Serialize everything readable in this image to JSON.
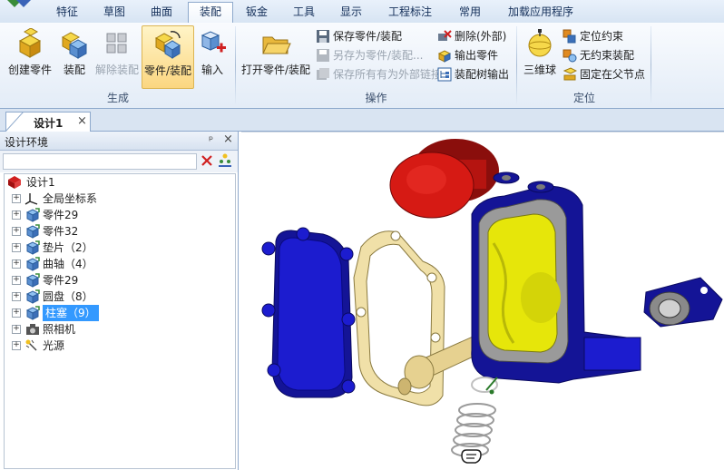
{
  "tabs": [
    "特征",
    "草图",
    "曲面",
    "装配",
    "钣金",
    "工具",
    "显示",
    "工程标注",
    "常用",
    "加载应用程序"
  ],
  "active_tab": "装配",
  "ribbon": {
    "groups": {
      "generate": "生成",
      "operate": "操作",
      "locate": "定位"
    },
    "buttons": {
      "create_part": "创建零件",
      "assemble": "装配",
      "disassemble": "解除装配",
      "part_assembly": "零件/装配",
      "import": "输入",
      "open_part_assembly": "打开零件/装配",
      "save_part_assembly": "保存零件/装配",
      "save_as_part_assembly": "另存为零件/装配...",
      "save_all_external": "保存所有有为外部链接",
      "delete_external": "删除(外部)",
      "export_part": "输出零件",
      "export_assembly_tree": "装配树输出",
      "triball": "三维球",
      "locate_constraint": "定位约束",
      "unconstrained_assembly": "无约束装配",
      "fix_at_parent": "固定在父节点"
    }
  },
  "document": {
    "tab_title": "设计1",
    "close_glyph": "×"
  },
  "panel": {
    "title": "设计环境",
    "pin_glyph": "ᵖ",
    "close_glyph": "×",
    "search_value": ""
  },
  "tree": {
    "root": "设计1",
    "items": [
      {
        "label": "全局坐标系",
        "icon": "axes-icon"
      },
      {
        "label": "零件29",
        "icon": "part-icon"
      },
      {
        "label": "零件32",
        "icon": "part-icon"
      },
      {
        "label": "垫片（2）",
        "icon": "part-icon"
      },
      {
        "label": "曲轴（4）",
        "icon": "part-icon"
      },
      {
        "label": "零件29",
        "icon": "part-icon"
      },
      {
        "label": "圆盘（8）",
        "icon": "part-icon"
      },
      {
        "label": "柱塞（9）",
        "icon": "part-icon",
        "selected": true
      },
      {
        "label": "照相机",
        "icon": "camera-icon"
      },
      {
        "label": "光源",
        "icon": "light-icon"
      }
    ]
  },
  "colors": {
    "cover_blue": "#1c1ccf",
    "cap_red": "#d61a14",
    "gasket_tan": "#f0e0a8",
    "rotor_yellow": "#e6e60a",
    "selection": "#3399ff"
  }
}
